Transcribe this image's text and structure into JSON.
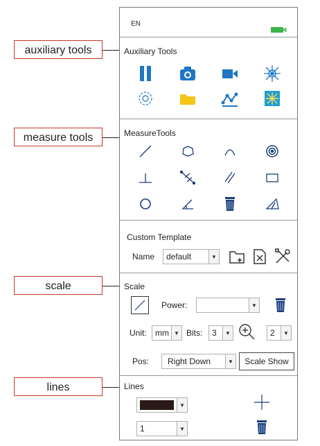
{
  "status": {
    "language": "EN"
  },
  "callouts": {
    "auxiliary": "auxiliary tools",
    "measure": "measure tools",
    "scale": "scale",
    "lines": "lines"
  },
  "auxiliary": {
    "title": "Auxiliary Tools",
    "icons": [
      "pause-icon",
      "camera-icon",
      "video-icon",
      "light-icon",
      "settings-icon",
      "folder-icon",
      "curve-icon",
      "brightness-icon"
    ]
  },
  "measure": {
    "title": "MeasureTools",
    "icons": [
      "line-icon",
      "polygon-icon",
      "arc-icon",
      "spiral-icon",
      "perpendicular-icon",
      "multi-line-icon",
      "parallel-icon",
      "rectangle-icon",
      "circle-icon",
      "angle-icon",
      "trash-icon",
      "polyline-icon"
    ]
  },
  "template": {
    "title": "Custom Template",
    "name_label": "Name",
    "name_value": "default"
  },
  "scale": {
    "title": "Scale",
    "power_label": "Power:",
    "power_value": "",
    "unit_label": "Unit:",
    "unit_value": "mm",
    "bits_label": "Bits:",
    "bits_value": "3",
    "zoom_value": "2",
    "pos_label": "Pos:",
    "pos_value": "Right Down",
    "show_button": "Scale Show"
  },
  "lines": {
    "title": "Lines",
    "color": "#2a1a18",
    "width_value": "1"
  },
  "colors": {
    "accent_blue": "#1f77c4",
    "battery": "#3bb54a",
    "folder": "#f5c518"
  }
}
